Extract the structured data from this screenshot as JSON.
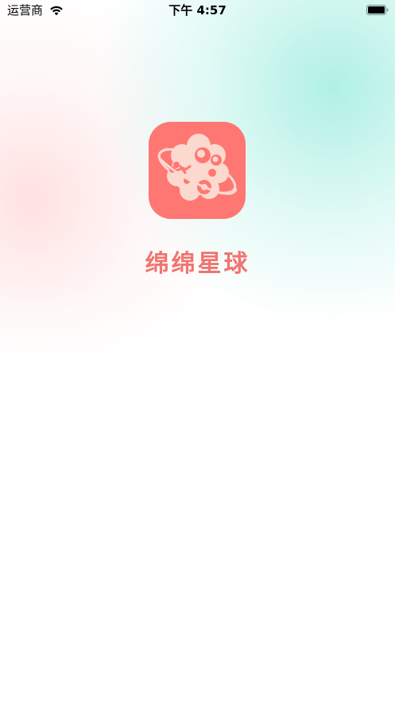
{
  "status_bar": {
    "carrier": "运营商",
    "time": "下午 4:57",
    "wifi_icon": "wifi-icon",
    "battery_icon": "battery-full-icon"
  },
  "splash": {
    "app_icon": "planet-logo-icon",
    "app_name": "绵绵星球",
    "brand_color": "#ff7772",
    "brand_text_color": "#f07470"
  }
}
